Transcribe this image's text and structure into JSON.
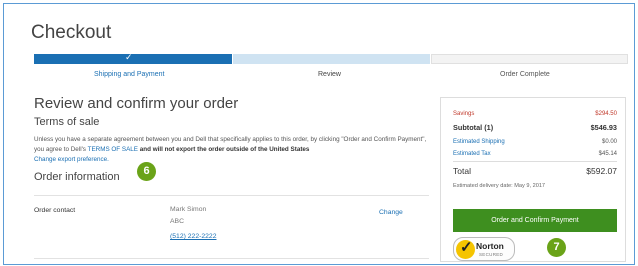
{
  "page": {
    "title": "Checkout"
  },
  "progress": {
    "steps": [
      {
        "label": "Shipping and Payment",
        "state": "complete"
      },
      {
        "label": "Review",
        "state": "current"
      },
      {
        "label": "Order Complete",
        "state": "upcoming"
      }
    ],
    "check_glyph": "✓"
  },
  "review": {
    "heading": "Review and confirm your order",
    "terms_heading": "Terms of sale",
    "terms_text_1": "Unless you have a separate agreement between you and Dell that specifically applies to this order, by clicking \"Order and Confirm Payment\", you agree to Dell's",
    "terms_link": "TERMS OF SALE",
    "terms_text_2": "and will not export the order outside of the United States",
    "export_link": "Change export preference."
  },
  "order_info": {
    "heading": "Order information",
    "contact_label": "Order contact",
    "contact_name": "Mark Simon",
    "contact_company": "ABC",
    "contact_phone": "(512) 222-2222",
    "change_link": "Change"
  },
  "summary": {
    "savings_label": "Savings",
    "savings_value": "$294.50",
    "subtotal_label": "Subtotal (1)",
    "subtotal_value": "$546.93",
    "shipping_label": "Estimated Shipping",
    "shipping_value": "$0.00",
    "tax_label": "Estimated Tax",
    "tax_value": "$45.14",
    "total_label": "Total",
    "total_value": "$592.07",
    "delivery_text": "Estimated delivery date: May 9, 2017",
    "confirm_button": "Order and Confirm Payment",
    "norton_text": "Norton",
    "norton_sub": "SECURED"
  },
  "annotations": {
    "badge_6": "6",
    "badge_7": "7"
  },
  "colors": {
    "accent": "#1a6fb3",
    "confirm": "#3e8f1f",
    "badge": "#6aa318",
    "savings": "#c0392b"
  }
}
